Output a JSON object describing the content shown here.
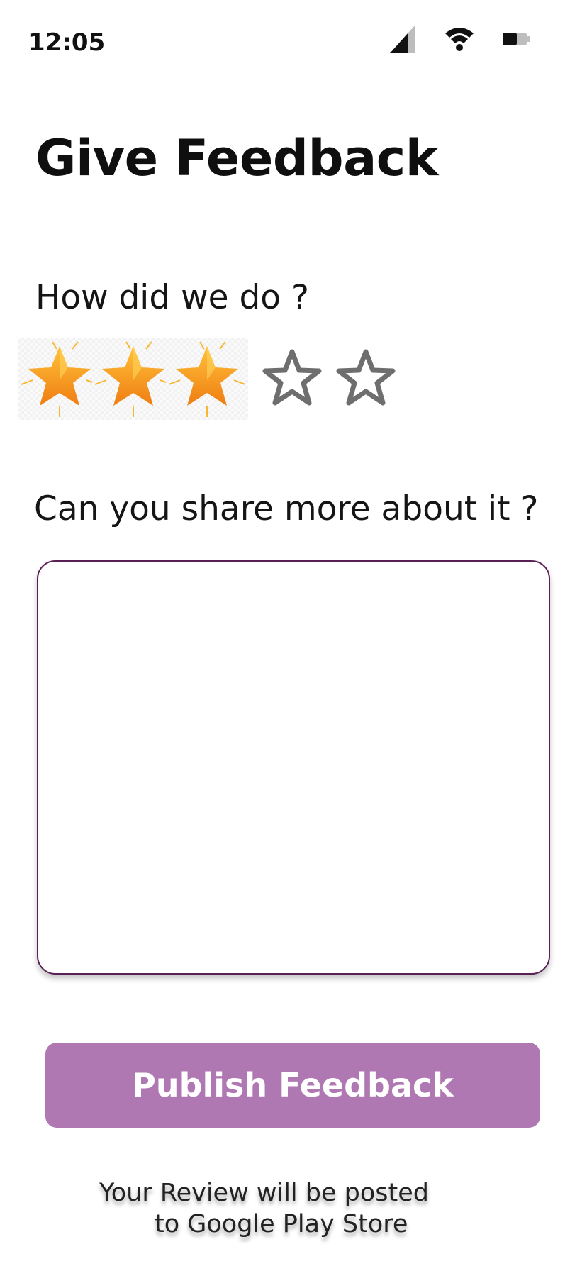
{
  "status_bar": {
    "time": "12:05",
    "icons": [
      "cellular-signal-icon",
      "wifi-icon",
      "battery-icon"
    ]
  },
  "page": {
    "title": "Give Feedback",
    "rating_question": "How did we do ?",
    "rating": {
      "value": 3,
      "max": 5
    },
    "details_question": "Can you share more about it ?",
    "feedback_value": "",
    "feedback_placeholder": "",
    "publish_label": "Publish Feedback",
    "footnote_line1": "Your Review will be posted",
    "footnote_line2": "to  Google  Play Store"
  },
  "colors": {
    "button_bg": "#b078b3",
    "textarea_border": "#5a1f55",
    "star_filled": "#f7a21f",
    "star_empty_outline": "#6e6e6e"
  }
}
